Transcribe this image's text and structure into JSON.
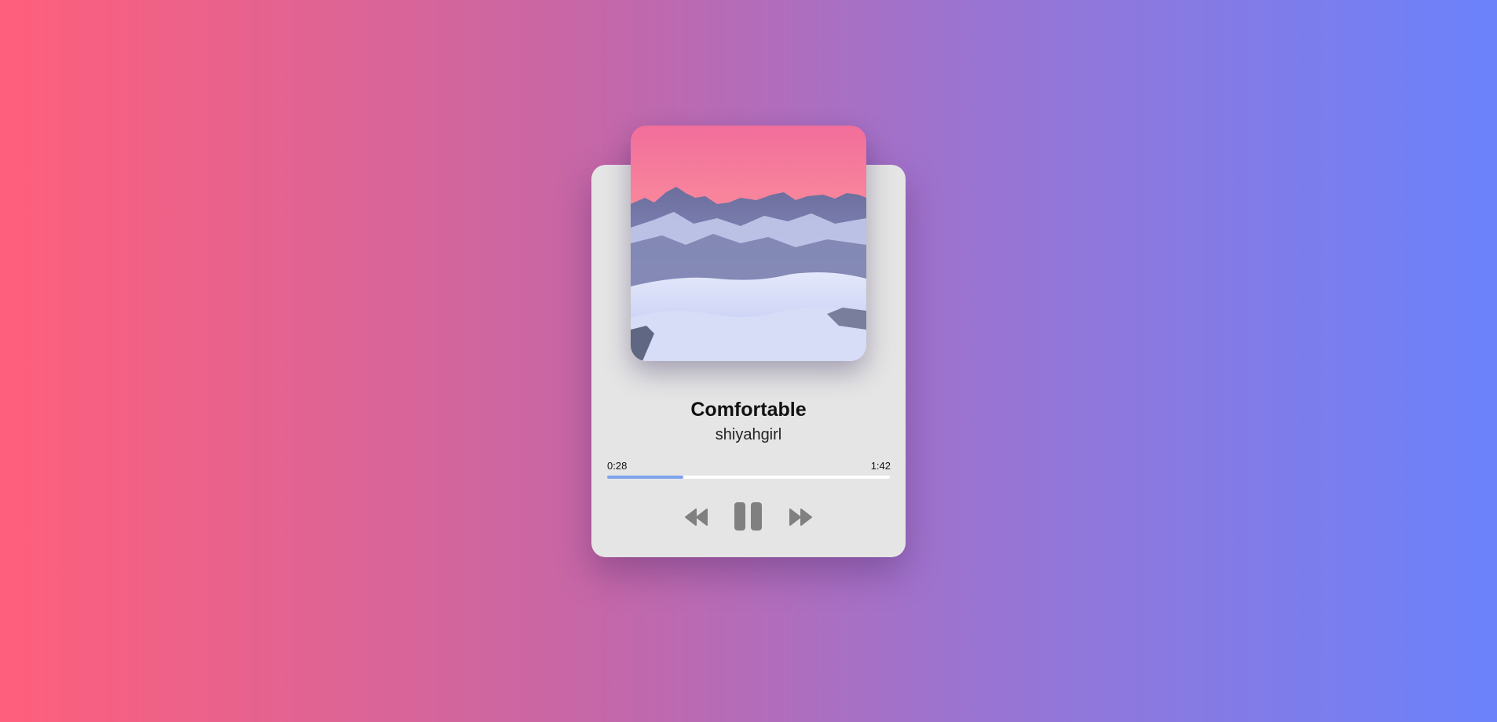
{
  "track": {
    "title": "Comfortable",
    "artist": "shiyahgirl",
    "current_time": "0:28",
    "duration": "1:42",
    "progress_fraction": 0.27
  },
  "cover": {
    "description_icon": "mountain-landscape-image"
  },
  "controls": {
    "prev_icon": "rewind-icon",
    "play_state_icon": "pause-icon",
    "next_icon": "fast-forward-icon"
  },
  "colors": {
    "card": "#e5e5e5",
    "progress_fill": "#7fa2ee",
    "progress_track": "#ffffff",
    "control_icon": "#808080",
    "bg_left": "#ff5f7b",
    "bg_right": "#6b82fb"
  }
}
